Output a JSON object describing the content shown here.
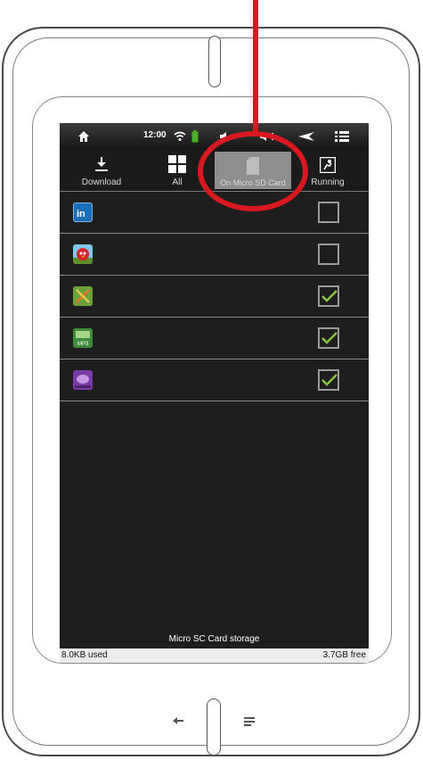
{
  "statusbar": {
    "time": "12:00",
    "icons": [
      "home-icon",
      "wifi-icon",
      "battery-icon",
      "volume-down-icon",
      "volume-up-icon",
      "back-arrow-icon",
      "menu-icon"
    ]
  },
  "tabs": [
    {
      "label": "Download",
      "icon": "download-icon",
      "active": false
    },
    {
      "label": "All",
      "icon": "grid-icon",
      "active": false
    },
    {
      "label": "On Micro SD Card",
      "icon": "sd-card-icon",
      "active": true
    },
    {
      "label": "Running",
      "icon": "running-icon",
      "active": false
    }
  ],
  "apps": [
    {
      "icon": "linkedin-app-icon",
      "checked": false
    },
    {
      "icon": "angry-birds-app-icon",
      "checked": false
    },
    {
      "icon": "green-app-icon",
      "checked": true
    },
    {
      "icon": "mp3-app-icon",
      "checked": true
    },
    {
      "icon": "bluetooth-app-icon",
      "checked": true
    }
  ],
  "storage": {
    "caption": "Micro SC Card storage",
    "used": "8.0KB used",
    "free": "3.7GB free"
  },
  "colors": {
    "annotation_red": "#d71920",
    "checkmark_green": "#8cc63f",
    "screen_bg": "#1e1e1e"
  },
  "device_nav": {
    "back_icon": "back-arrow-icon",
    "menu_icon": "menu-lines-icon"
  }
}
